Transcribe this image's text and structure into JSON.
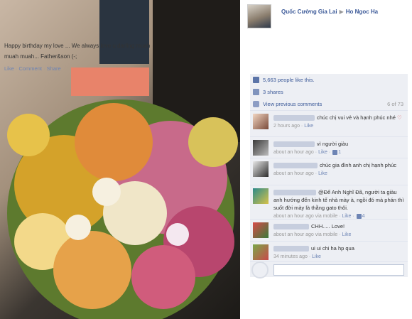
{
  "post": {
    "author": "Quốc Cường Gia Lai",
    "arrow": "▶",
    "target": "Ho Ngoc Ha",
    "message": "Happy birthday my love ... We always love u darling muah muah muah... Father&son (-;",
    "actions": {
      "like": "Like",
      "comment": "Comment",
      "share": "Share",
      "sep": "·"
    }
  },
  "ufi": {
    "likes_text": "5,663 people like this.",
    "shares_text": "3 shares",
    "view_previous": "View previous comments",
    "count": "6 of 73"
  },
  "comments": [
    {
      "text": "chúc chị vui vẻ và hạnh phúc nhé",
      "emoji": "♡",
      "time": "2 hours ago",
      "like": "Like",
      "likes": ""
    },
    {
      "text": "vì người giàu",
      "emoji": "",
      "time": "about an hour ago",
      "like": "Like",
      "likes": "1"
    },
    {
      "text": "chúc gia đình anh chị hạnh phúc",
      "emoji": "",
      "time": "about an hour ago",
      "like": "Like",
      "likes": ""
    },
    {
      "text": "@Để Anh Nghĩ Đã, người ta giàu anh hướng đến kinh tế nhà mày à, ngồi đó mà phán thì suốt đời mày là thằng gato thôi.",
      "emoji": "",
      "time": "about an hour ago via mobile",
      "like": "Like",
      "likes": "4"
    },
    {
      "text": "CHH..... Love!",
      "emoji": "",
      "time": "about an hour ago via mobile",
      "like": "Like",
      "likes": ""
    },
    {
      "text": "ui ui chi ha hp qua",
      "emoji": "",
      "time": "34 minutes ago",
      "like": "Like",
      "likes": ""
    }
  ],
  "colors": {
    "link": "#3b5998",
    "ufi_bg": "#edeff4"
  }
}
